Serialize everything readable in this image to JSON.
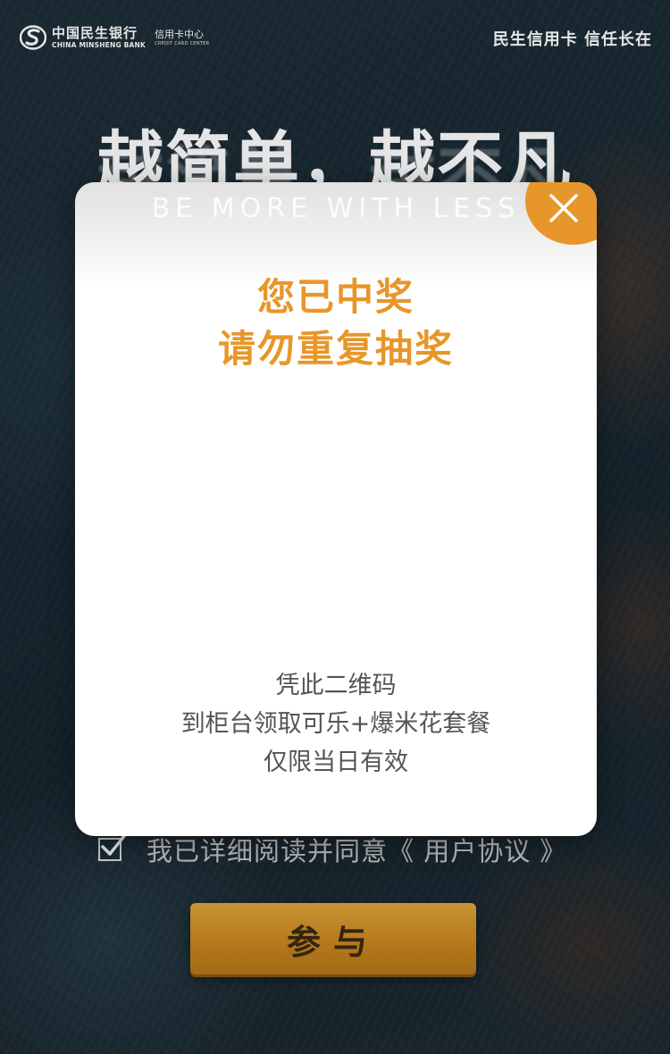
{
  "header": {
    "bank_name_cn": "中国民生银行",
    "bank_name_en": "CHINA MINSHENG BANK",
    "sub_cn": "信用卡中心",
    "sub_en": "CREDIT CARD CENTER",
    "slogan": "民生信用卡 信任长在"
  },
  "hero": {
    "title": "越简单，越不凡",
    "subtitle_en": "BE MORE WITH LESS"
  },
  "agreement": {
    "checked": true,
    "text": "我已详细阅读并同意《 用户协议 》"
  },
  "join_button": {
    "label": "参与"
  },
  "modal": {
    "title_line1": "您已中奖",
    "title_line2": "请勿重复抽奖",
    "info_line1": "凭此二维码",
    "info_line2": "到柜台领取可乐+爆米花套餐",
    "info_line3": "仅限当日有效",
    "close_icon": "close-icon"
  },
  "colors": {
    "accent": "#e8962a",
    "button": "#c98820",
    "background": "#1b2a33"
  }
}
